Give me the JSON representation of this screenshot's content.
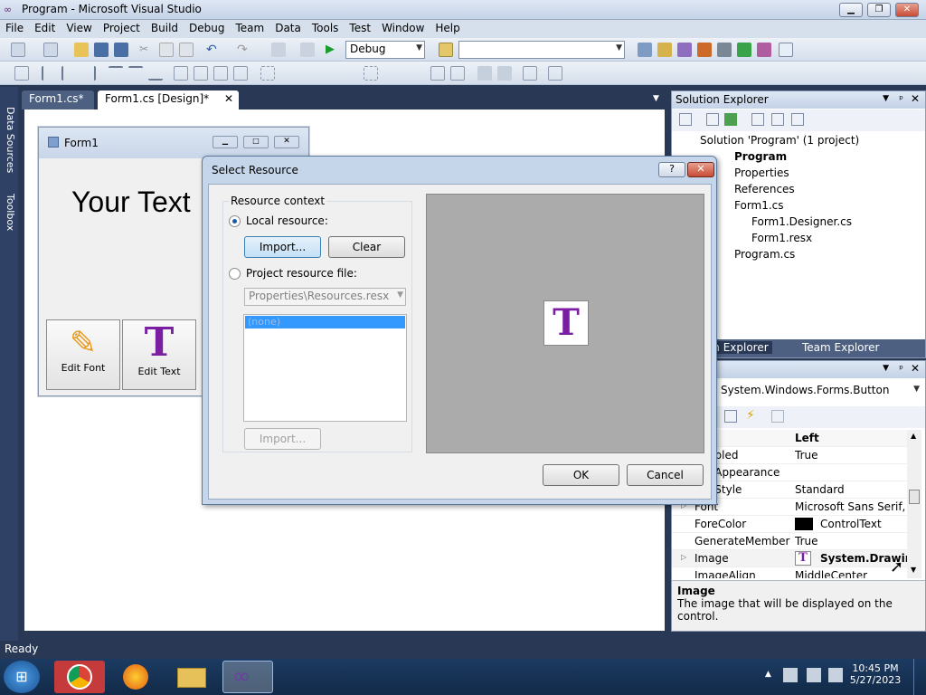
{
  "window": {
    "title": "Program - Microsoft Visual Studio"
  },
  "menu": [
    "File",
    "Edit",
    "View",
    "Project",
    "Build",
    "Debug",
    "Team",
    "Data",
    "Tools",
    "Test",
    "Window",
    "Help"
  ],
  "toolbar": {
    "config": "Debug",
    "search_value": ""
  },
  "side_tabs": [
    "Data Sources",
    "Toolbox"
  ],
  "doc_tabs": [
    "Form1.cs*",
    "Form1.cs [Design]*"
  ],
  "form1": {
    "title": "Form1",
    "label_text": "Your Text",
    "buttons": [
      "Edit Font",
      "Edit Text"
    ]
  },
  "solution_explorer": {
    "title": "Solution Explorer",
    "items": [
      "Solution 'Program' (1 project)",
      "Program",
      "Properties",
      "References",
      "Form1.cs",
      "Form1.Designer.cs",
      "Form1.resx",
      "Program.cs"
    ],
    "bottom_tabs": [
      "Solution Explorer",
      "Team Explorer"
    ]
  },
  "properties": {
    "object": "System.Windows.Forms.Button",
    "rows": [
      {
        "name": "",
        "value": "Left",
        "bold": true
      },
      {
        "name": "Enabled",
        "value": "True"
      },
      {
        "name": "FlatAppearance",
        "value": ""
      },
      {
        "name": "FlatStyle",
        "value": "Standard"
      },
      {
        "name": "Font",
        "value": "Microsoft Sans Serif, 8..."
      },
      {
        "name": "ForeColor",
        "value": "ControlText"
      },
      {
        "name": "GenerateMember",
        "value": "True"
      },
      {
        "name": "Image",
        "value": "System.Drawing."
      },
      {
        "name": "ImageAlign",
        "value": "MiddleCenter"
      }
    ],
    "desc_title": "Image",
    "desc_text": "The image that will be displayed on the control."
  },
  "dialog": {
    "title": "Select Resource",
    "help": "?",
    "group": "Resource context",
    "local": "Local resource:",
    "import": "Import...",
    "clear": "Clear",
    "project": "Project resource file:",
    "resx": "Properties\\Resources.resx",
    "list_selected": "(none)",
    "import2": "Import...",
    "ok": "OK",
    "cancel": "Cancel"
  },
  "status": "Ready",
  "clock": {
    "time": "10:45 PM",
    "date": "5/27/2023"
  },
  "colors": {
    "accent": "#7b1fa2",
    "selection": "#3399ff"
  }
}
